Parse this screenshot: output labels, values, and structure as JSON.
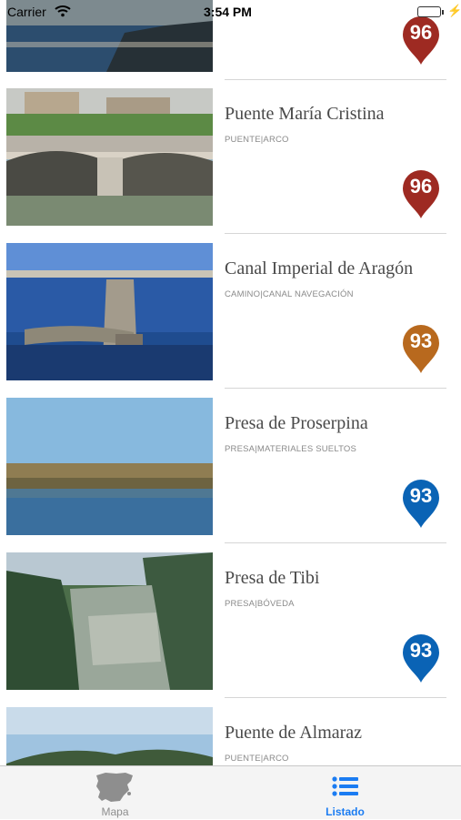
{
  "status_bar": {
    "carrier": "Carrier",
    "time": "3:54 PM"
  },
  "colors": {
    "pin_red": "#9e2a22",
    "pin_orange": "#b8691e",
    "pin_blue": "#0a63b5",
    "tab_active": "#1b7cf2",
    "tab_inactive": "#8e8e8e"
  },
  "list": {
    "items": [
      {
        "title": "",
        "subtitle": "",
        "score": "96",
        "pin_color": "#9e2a22",
        "image": "river-landscape"
      },
      {
        "title": "Puente María Cristina",
        "subtitle": "PUENTE|ARCO",
        "score": "96",
        "pin_color": "#9e2a22",
        "image": "stone-bridge-photo"
      },
      {
        "title": "Canal Imperial de Aragón",
        "subtitle": "CAMINO|CANAL NAVEGACIÓN",
        "score": "93",
        "pin_color": "#b8691e",
        "image": "canal-weir-photo"
      },
      {
        "title": "Presa de Proserpina",
        "subtitle": "PRESA|MATERIALES SUELTOS",
        "score": "93",
        "pin_color": "#0a63b5",
        "image": "dam-reservoir-photo"
      },
      {
        "title": "Presa de Tibi",
        "subtitle": "PRESA|BÓVEDA",
        "score": "93",
        "pin_color": "#0a63b5",
        "image": "arch-dam-canyon-photo"
      },
      {
        "title": "Puente de Almaraz",
        "subtitle": "PUENTE|ARCO",
        "score": "",
        "pin_color": "",
        "image": "sky-hills-photo"
      }
    ]
  },
  "tabbar": {
    "tabs": [
      {
        "label": "Mapa",
        "icon": "spain-map-icon",
        "active": false
      },
      {
        "label": "Listado",
        "icon": "list-icon",
        "active": true
      }
    ]
  }
}
